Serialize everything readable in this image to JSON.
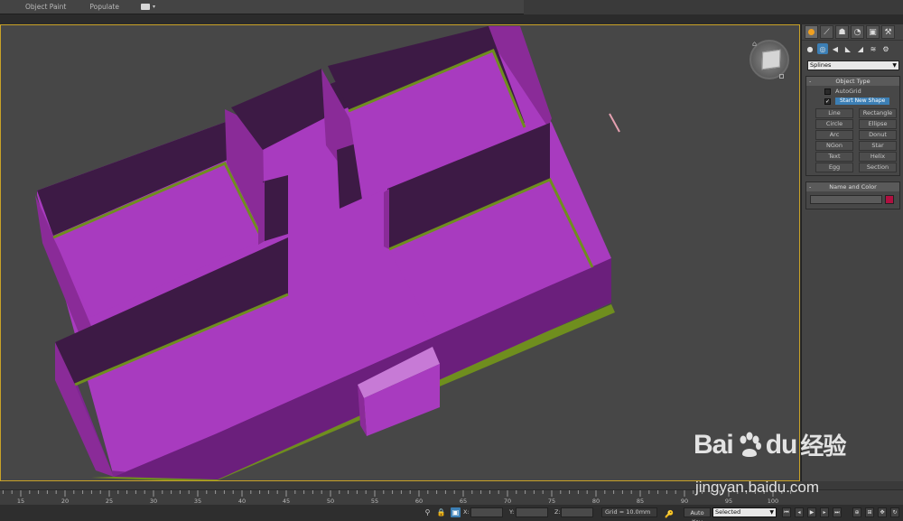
{
  "ribbon": {
    "tabs": [
      "Object Paint",
      "Populate"
    ]
  },
  "command_panel": {
    "category_dropdown": "Splines",
    "object_type": {
      "title": "Object Type",
      "autogrid_label": "AutoGrid",
      "start_new_shape_label": "Start New Shape",
      "buttons": [
        "Line",
        "Rectangle",
        "Circle",
        "Ellipse",
        "Arc",
        "Donut",
        "NGon",
        "Star",
        "Text",
        "Helix",
        "Egg",
        "Section"
      ]
    },
    "name_and_color": {
      "title": "Name and Color",
      "name_value": "",
      "color": "#b01040"
    }
  },
  "viewport": {
    "floor_color": "#a83bbf",
    "wall_top_color": "#3d1a45",
    "wall_side_color": "#8a2b98",
    "trim_color": "#6f8e1e",
    "background": "#474747",
    "active_border": "#c9a227"
  },
  "trackbar": {
    "ticks": [
      "15",
      "20",
      "25",
      "30",
      "35",
      "40",
      "45",
      "50",
      "55",
      "60",
      "65",
      "70",
      "75",
      "80",
      "85",
      "90",
      "95",
      "100"
    ]
  },
  "statusbar": {
    "x_label": "X:",
    "y_label": "Y:",
    "z_label": "Z:",
    "grid_text": "Grid = 10.0mm",
    "autokey_label": "Auto Key",
    "selected_dropdown": "Selected"
  },
  "watermark": {
    "brand": "Bai",
    "brand_suffix": "du",
    "brand_cn": "经验",
    "url": "jingyan.baidu.com"
  }
}
